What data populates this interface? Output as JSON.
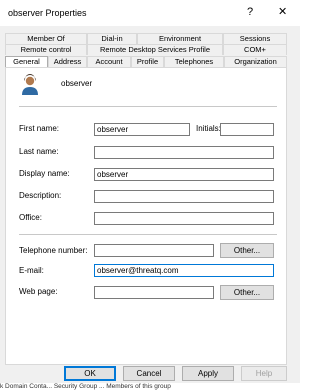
{
  "window": {
    "title": "observer Properties",
    "help_glyph": "?",
    "close_glyph": "✕"
  },
  "tabs": {
    "row1": [
      "Member Of",
      "Dial-in",
      "Environment",
      "Sessions"
    ],
    "row2": [
      "Remote control",
      "Remote Desktop Services Profile",
      "COM+"
    ],
    "row3": [
      "General",
      "Address",
      "Account",
      "Profile",
      "Telephones",
      "Organization"
    ],
    "active": "General"
  },
  "general": {
    "display_header": "observer",
    "first_name_label": "First name:",
    "first_name_value": "observer",
    "initials_label": "Initials:",
    "initials_value": "",
    "last_name_label": "Last name:",
    "last_name_value": "",
    "display_name_label": "Display name:",
    "display_name_value": "observer",
    "description_label": "Description:",
    "description_value": "",
    "office_label": "Office:",
    "office_value": "",
    "telephone_label": "Telephone number:",
    "telephone_value": "",
    "email_label": "E-mail:",
    "email_value": "observer@threatq.com",
    "webpage_label": "Web page:",
    "webpage_value": "",
    "other_button": "Other..."
  },
  "buttons": {
    "ok": "OK",
    "cancel": "Cancel",
    "apply": "Apply",
    "help": "Help"
  },
  "background_text": "k Domain Conta...  Security Group ...  Members of this group"
}
